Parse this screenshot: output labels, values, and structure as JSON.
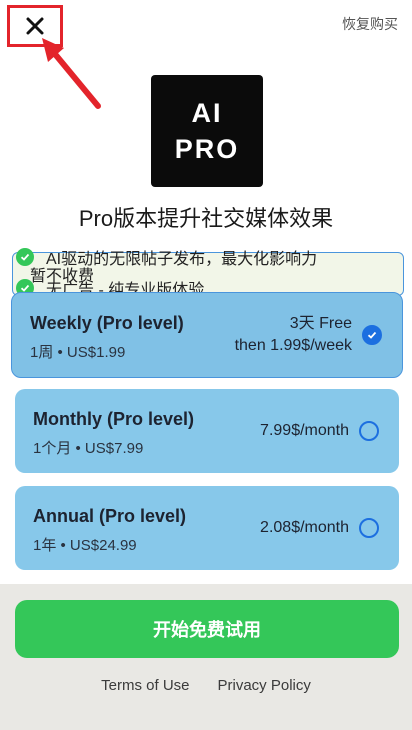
{
  "header": {
    "close_icon": "close-icon",
    "restore_label": "恢复购买",
    "annotation_color": "#e3242b"
  },
  "logo": {
    "line1": "AI",
    "line2": "PRO"
  },
  "headline": "Pro版本提升社交媒体效果",
  "features": {
    "item1": "AI驱动的无限帖子发布，最大化影响力",
    "overlap": "暂不收费",
    "item2": "无广告 - 纯专业版体验"
  },
  "plans": [
    {
      "name": "Weekly (Pro level)",
      "sub": "1周 • US$1.99",
      "price_line1": "3天 Free",
      "price_line2": "then 1.99$/week",
      "selected": true
    },
    {
      "name": "Monthly (Pro level)",
      "sub": "1个月 • US$7.99",
      "price_line1": "7.99$/month",
      "selected": false
    },
    {
      "name": "Annual (Pro level)",
      "sub": "1年 • US$24.99",
      "price_line1": "2.08$/month",
      "selected": false
    }
  ],
  "cta_label": "开始免费试用",
  "footer": {
    "terms": "Terms of Use",
    "privacy": "Privacy Policy"
  },
  "colors": {
    "accent_green": "#34c759",
    "plan_blue": "#87c8ea",
    "radio_blue": "#1c6fe0"
  }
}
